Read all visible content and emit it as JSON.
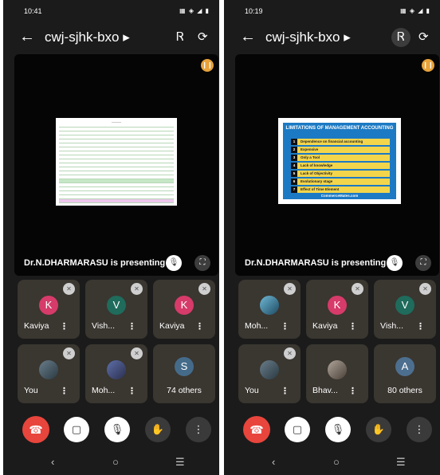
{
  "left": {
    "time": "10:41",
    "status_icons": "▦ ◈ ◢ ▮",
    "meeting_code": "cwj-sjhk-bxo ▸",
    "presenter_label": "Dr.N.DHARMARASU is presenting",
    "tiles": [
      {
        "name": "Kaviya",
        "initial": "K",
        "color": "#d63b6a"
      },
      {
        "name": "Vish...",
        "initial": "V",
        "color": "#1f6b5c"
      },
      {
        "name": "Kaviya",
        "initial": "K",
        "color": "#d63b6a"
      },
      {
        "name": "You",
        "photo": true
      },
      {
        "name": "Moh...",
        "photo": true
      },
      {
        "initial": "S",
        "color": "#456b8a",
        "others": "74 others"
      }
    ]
  },
  "right": {
    "time": "10:19",
    "status_icons": "▦ ◈ ◢ ▮",
    "meeting_code": "cwj-sjhk-bxo ▸",
    "presenter_label": "Dr.N.DHARMARASU is presenting",
    "slide": {
      "title": "LIMITATIONS OF MANAGEMENT ACCOUNTING",
      "rows": [
        "Dependence on financial accounting",
        "Expensive",
        "Only a Tool",
        "Lack of knowledge",
        "Lack of Objectivity",
        "Evolutionary stage",
        "Effect of Time Element"
      ],
      "footer": "CommerceMates.com"
    },
    "tiles": [
      {
        "name": "Moh...",
        "photo": true
      },
      {
        "name": "Kaviya",
        "initial": "K",
        "color": "#d63b6a"
      },
      {
        "name": "Vish...",
        "initial": "V",
        "color": "#1f6b5c"
      },
      {
        "name": "You",
        "photo": true
      },
      {
        "name": "Bhav...",
        "photo": true
      },
      {
        "initial": "A",
        "color": "#4d6f8f",
        "others": "80 others"
      }
    ]
  },
  "icons": {
    "back": "back-arrow-icon",
    "bluetooth": "bluetooth-icon",
    "camera_switch": "camera-switch-icon",
    "mic_off": "mic-off-icon",
    "camera_off": "camera-off-icon",
    "hand": "raise-hand-icon",
    "more": "more-vert-icon",
    "end_call": "end-call-icon"
  },
  "nav": {
    "back": "‹",
    "home": "○",
    "recents": "☰"
  }
}
